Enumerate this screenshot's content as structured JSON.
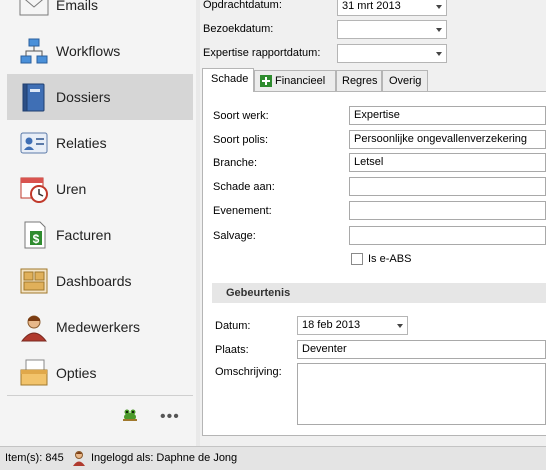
{
  "nav": {
    "items": [
      {
        "label": "Emails",
        "icon": "envelope-icon"
      },
      {
        "label": "Workflows",
        "icon": "workflow-icon"
      },
      {
        "label": "Dossiers",
        "icon": "book-icon",
        "active": true
      },
      {
        "label": "Relaties",
        "icon": "contact-card-icon"
      },
      {
        "label": "Uren",
        "icon": "calendar-clock-icon"
      },
      {
        "label": "Facturen",
        "icon": "invoice-icon"
      },
      {
        "label": "Dashboards",
        "icon": "dashboard-icon"
      },
      {
        "label": "Medewerkers",
        "icon": "employee-icon"
      },
      {
        "label": "Opties",
        "icon": "options-icon"
      }
    ],
    "more_label": "•••"
  },
  "header_fields": {
    "opdrachtdatum": {
      "label": "Opdrachtdatum:",
      "value": "31 mrt 2013"
    },
    "bezoekdatum": {
      "label": "Bezoekdatum:",
      "value": ""
    },
    "expertise": {
      "label": "Expertise rapportdatum:",
      "value": ""
    }
  },
  "tabs": [
    {
      "label": "Schade",
      "active": true
    },
    {
      "label": "Financieel",
      "icon": "financial-icon"
    },
    {
      "label": "Regres"
    },
    {
      "label": "Overig"
    }
  ],
  "schade": {
    "soort_werk": {
      "label": "Soort werk:",
      "value": "Expertise"
    },
    "soort_polis": {
      "label": "Soort polis:",
      "value": "Persoonlijke ongevallenverzekering"
    },
    "branche": {
      "label": "Branche:",
      "value": "Letsel"
    },
    "schade_aan": {
      "label": "Schade aan:",
      "value": ""
    },
    "evenement": {
      "label": "Evenement:",
      "value": ""
    },
    "salvage": {
      "label": "Salvage:",
      "value": ""
    },
    "eabs": {
      "label": "Is e-ABS",
      "checked": false
    }
  },
  "gebeurtenis": {
    "title": "Gebeurtenis",
    "datum": {
      "label": "Datum:",
      "value": "18 feb 2013"
    },
    "plaats": {
      "label": "Plaats:",
      "value": "Deventer"
    },
    "omschrijving": {
      "label": "Omschrijving:",
      "value": ""
    }
  },
  "status": {
    "items_label": "Item(s): 845",
    "user_label": "Ingelogd als: Daphne de Jong"
  },
  "colors": {
    "active_nav": "#d6d6d6",
    "accent_green": "#2e8b2e"
  }
}
